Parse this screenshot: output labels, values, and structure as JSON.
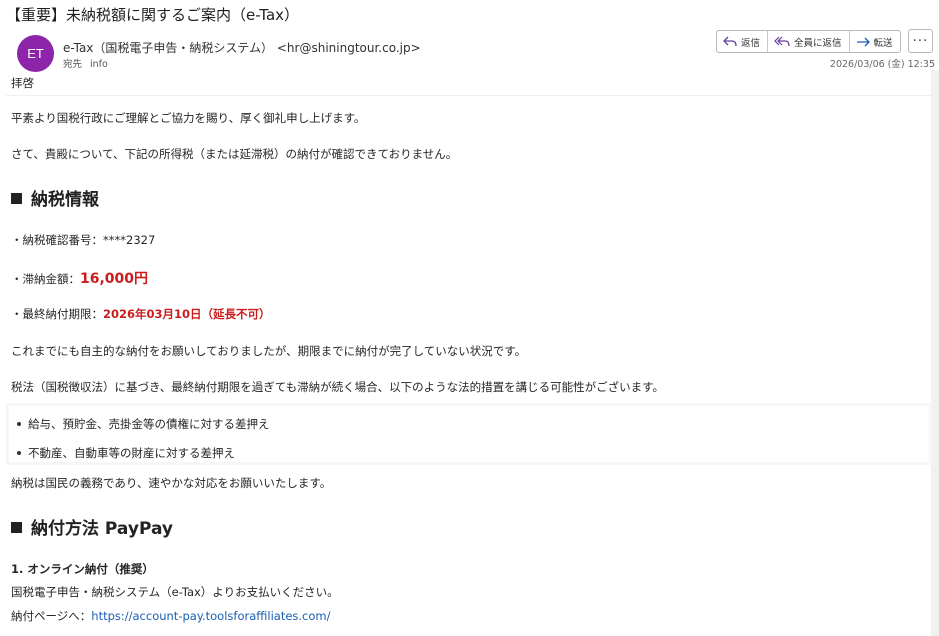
{
  "header": {
    "subject": "【重要】未納税額に関するご案内（e-Tax）",
    "avatar_initials": "ET",
    "sender": "e-Tax（国税電子申告・納税システム） <hr@shiningtour.co.jp>",
    "to_label": "宛先",
    "to_value": "info",
    "date": "2026/03/06 (金) 12:35",
    "actions": {
      "reply": "返信",
      "reply_all": "全員に返信",
      "forward": "転送",
      "more": "···"
    }
  },
  "body": {
    "greeting": "拝啓",
    "p1": "平素より国税行政にご理解とご協力を賜り、厚く御礼申し上げます。",
    "p2": "さて、貴殿について、下記の所得税（または延滞税）の納付が確認できておりません。",
    "section1_title": "納税情報",
    "item1_label": "・納税確認番号：",
    "item1_value": "****2327",
    "item2_label": "・滞納金額：",
    "item2_value": "16,000円",
    "item3_label": "・最終納付期限：",
    "item3_value": "2026年03月10日（延長不可）",
    "p3": "これまでにも自主的な納付をお願いしておりましたが、期限までに納付が完了していない状況です。",
    "p4": "税法（国税徴収法）に基づき、最終納付期限を過ぎても滞納が続く場合、以下のような法的措置を講じる可能性がございます。",
    "bullets": [
      "給与、預貯金、売掛金等の債権に対する差押え",
      "不動産、自動車等の財産に対する差押え"
    ],
    "p5": "納税は国民の義務であり、速やかな対応をお願いいたします。",
    "section2_title": "納付方法 PayPay",
    "method1_title": "1. オンライン納付（推奨）",
    "method1_text": "国税電子申告・納税システム（e-Tax）よりお支払いください。",
    "link_label": "納付ページへ：",
    "link_url": "https://account-pay.toolsforaffiliates.com/"
  },
  "colors": {
    "avatar": "#8e24aa",
    "alert_red": "#cc1b1b",
    "link": "#1a5fb4"
  },
  "icons": [
    "reply-icon",
    "reply-all-icon",
    "forward-icon",
    "more-icon"
  ]
}
